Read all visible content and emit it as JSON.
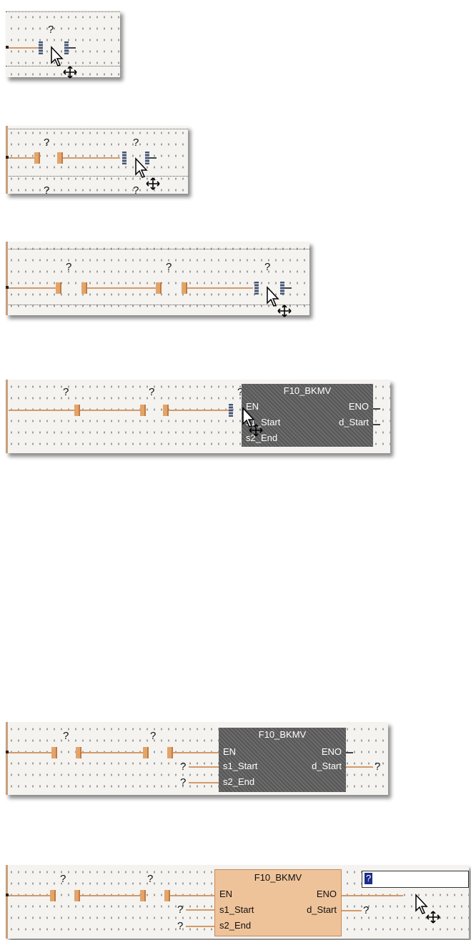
{
  "placeholder": "?",
  "function_block": {
    "title": "F10_BKMV",
    "pin_en": "EN",
    "pin_eno": "ENO",
    "pin_s1": "s1_Start",
    "pin_d": "d_Start",
    "pin_s2": "s2_End"
  },
  "edit_box": {
    "selected_text": "?"
  },
  "colors": {
    "contact": "#e3a46a",
    "selected_contact": "#44546f",
    "function_block_selected": "#5f5f5f",
    "function_block_placed": "#efc39a",
    "edit_selection": "#1a2d8a"
  },
  "icons": [
    "pointer-cursor-icon",
    "move-cross-icon"
  ]
}
